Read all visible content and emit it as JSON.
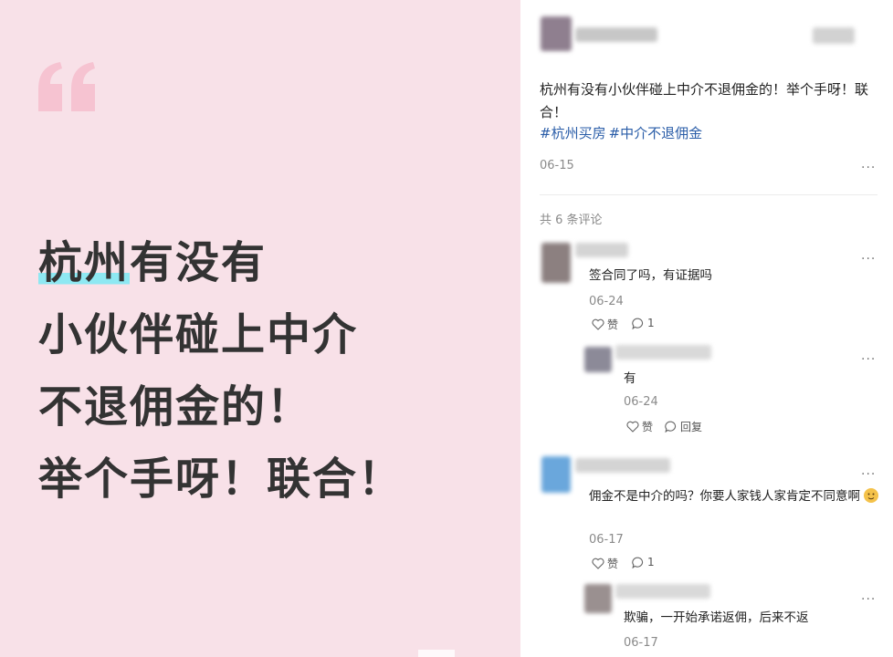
{
  "quote_card": {
    "lines": [
      "杭州有没有",
      "小伙伴碰上中介",
      "不退佣金的！",
      "举个手呀！联合！"
    ],
    "highlight": "杭州",
    "line1_rest": "有没有",
    "accent_color": "#f7c5d2",
    "highlight_color": "#8ee8f2"
  },
  "post": {
    "text": "杭州有没有小伙伴碰上中介不退佣金的！举个手呀！联合！",
    "hashtags": [
      "#杭州买房",
      "#中介不退佣金"
    ],
    "date": "06-15",
    "more": "···"
  },
  "comments": {
    "count_label": "共 6 条评论",
    "items": [
      {
        "text": "签合同了吗，有证据吗",
        "date": "06-24",
        "like_label": "赞",
        "reply_count": "1",
        "reply": {
          "text": "有",
          "date": "06-24",
          "like_label": "赞",
          "reply_label": "回复"
        }
      },
      {
        "text": "佣金不是中介的吗？你要人家钱人家肯定不同意啊",
        "date": "06-17",
        "like_label": "赞",
        "reply_count": "1",
        "reply": {
          "text": "欺骗，一开始承诺返佣，后来不返",
          "date": "06-17"
        }
      }
    ]
  },
  "icons": [
    "quote-mark-icon",
    "heart-icon",
    "comment-icon",
    "more-icon",
    "emoji-icon"
  ]
}
